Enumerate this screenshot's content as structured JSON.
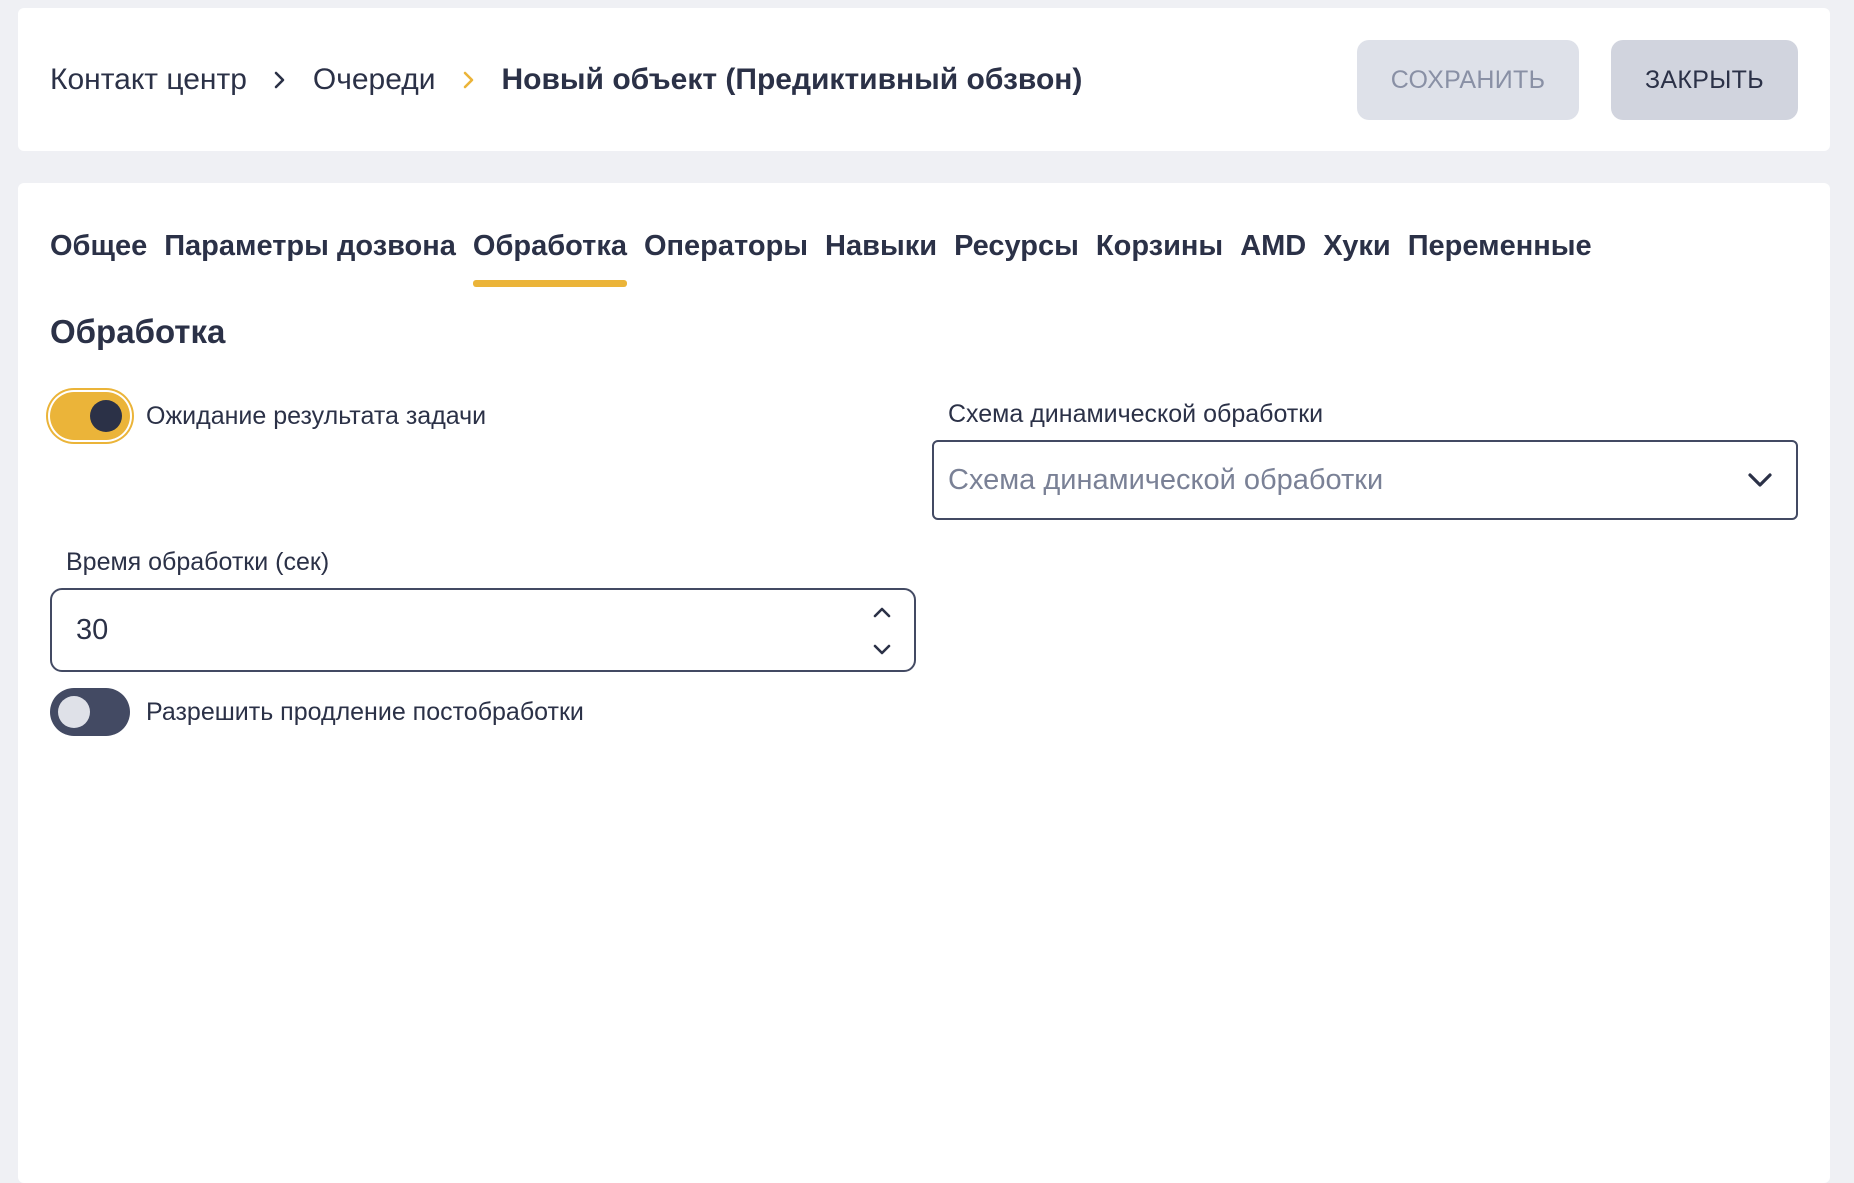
{
  "breadcrumb": {
    "items": [
      "Контакт центр",
      "Очереди",
      "Новый объект (Предиктивный обзвон)"
    ]
  },
  "toolbar": {
    "save_label": "СОХРАНИТЬ",
    "close_label": "ЗАКРЫТЬ"
  },
  "tabs": [
    {
      "label": "Общее"
    },
    {
      "label": "Параметры дозвона"
    },
    {
      "label": "Обработка",
      "active": true
    },
    {
      "label": "Операторы"
    },
    {
      "label": "Навыки"
    },
    {
      "label": "Ресурсы"
    },
    {
      "label": "Корзины"
    },
    {
      "label": "AMD"
    },
    {
      "label": "Хуки"
    },
    {
      "label": "Переменные"
    }
  ],
  "section": {
    "title": "Обработка",
    "wait_result": {
      "label": "Ожидание результата задачи",
      "enabled": true
    },
    "schema": {
      "label": "Схема динамической обработки",
      "placeholder": "Схема динамической обработки"
    },
    "processing_time": {
      "label": "Время обработки (сек)",
      "value": "30"
    },
    "allow_extension": {
      "label": "Разрешить продление постобработки",
      "enabled": false
    }
  },
  "colors": {
    "accent": "#ebb439",
    "text": "#2b3147",
    "background": "#eff0f4"
  }
}
